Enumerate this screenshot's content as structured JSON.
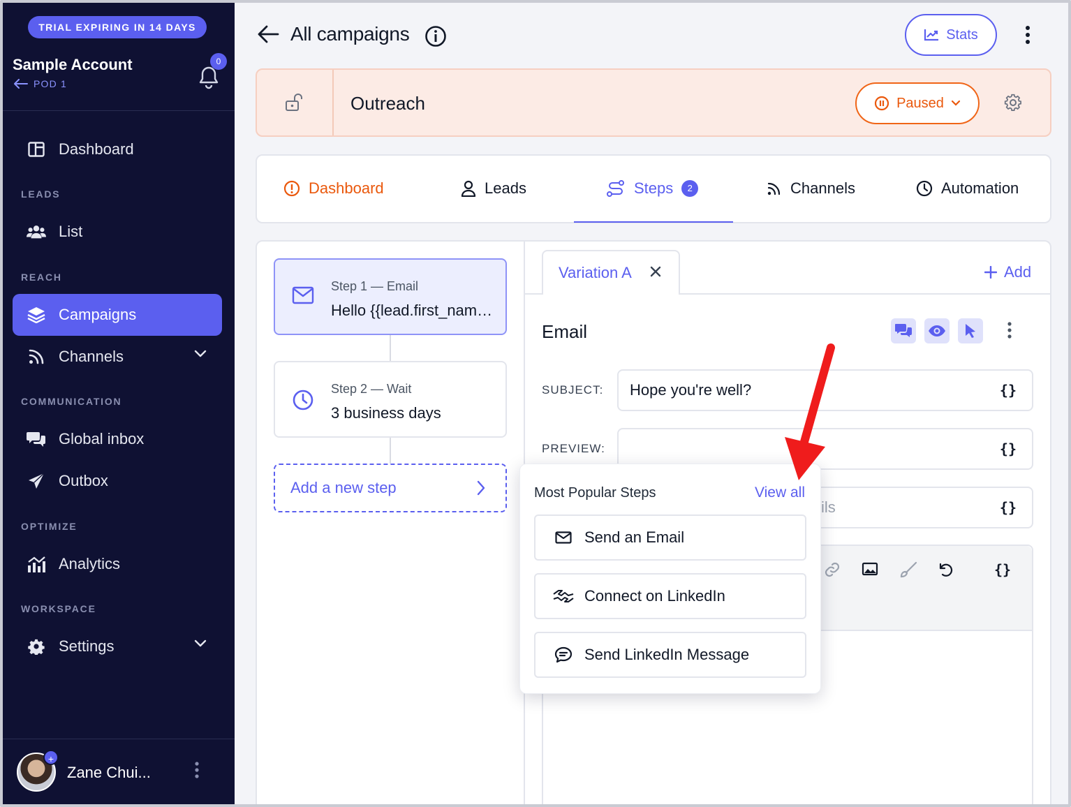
{
  "sidebar": {
    "trial_badge": "TRIAL EXPIRING IN 14 DAYS",
    "account_name": "Sample Account",
    "pod_label": "POD 1",
    "notification_count": "0",
    "sections": {
      "leads": "LEADS",
      "reach": "REACH",
      "communication": "COMMUNICATION",
      "optimize": "OPTIMIZE",
      "workspace": "WORKSPACE"
    },
    "items": {
      "dashboard": "Dashboard",
      "list": "List",
      "campaigns": "Campaigns",
      "channels": "Channels",
      "global_inbox": "Global inbox",
      "outbox": "Outbox",
      "analytics": "Analytics",
      "settings": "Settings"
    },
    "user_name": "Zane Chui...",
    "accent_color": "#5b5fef",
    "background_color": "#0f1133"
  },
  "header": {
    "title": "All campaigns",
    "stats_label": "Stats"
  },
  "campaign": {
    "name": "Outreach",
    "status_label": "Paused",
    "status_color": "#ea580c"
  },
  "tabs": {
    "dashboard": "Dashboard",
    "leads": "Leads",
    "steps": "Steps",
    "steps_count": "2",
    "channels": "Channels",
    "automation": "Automation"
  },
  "steps": [
    {
      "label": "Step 1 — Email",
      "value": "Hello {{lead.first_name}}"
    },
    {
      "label": "Step 2 — Wait",
      "value": "3 business days"
    }
  ],
  "add_step_label": "Add a new step",
  "variation": {
    "tab_label": "Variation A",
    "add_label": "Add"
  },
  "email": {
    "title": "Email",
    "subject_label": "SUBJECT:",
    "subject_value": "Hope you're well?",
    "preview_label": "PREVIEW:",
    "third_field_partial": "ils",
    "brace": "{}"
  },
  "popover": {
    "title": "Most Popular Steps",
    "view_all": "View all",
    "items": [
      "Send an Email",
      "Connect on LinkedIn",
      "Send LinkedIn Message"
    ]
  }
}
